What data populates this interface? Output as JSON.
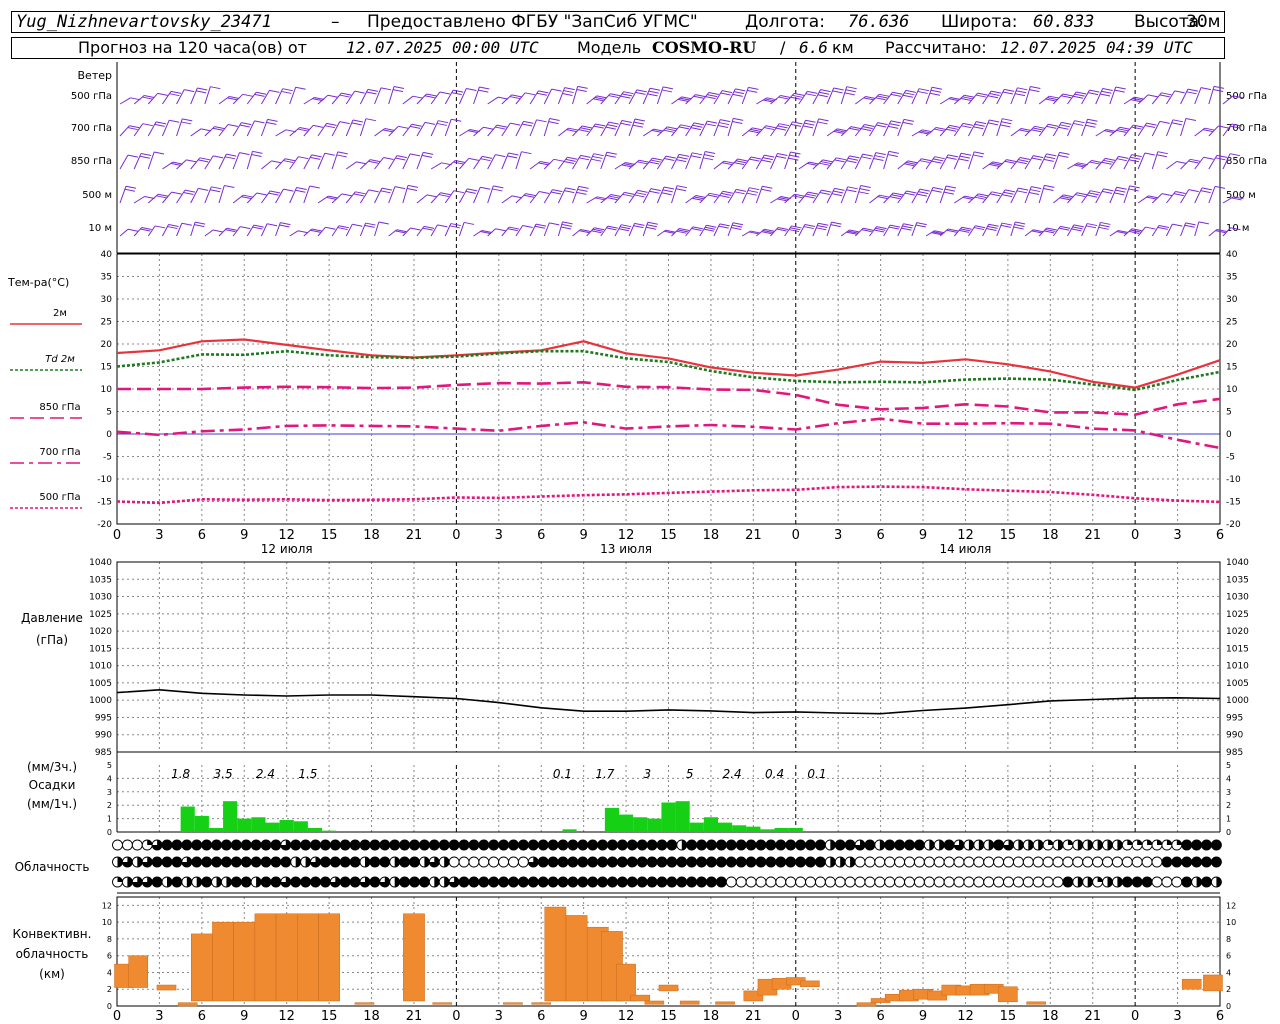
{
  "header": {
    "station": "Yug_Nizhnevartovsky_23471",
    "dash": "–",
    "provider": "Предоставлено ФГБУ \"ЗапСиб УГМС\"",
    "lon_label": "Долгота:",
    "lon_value": "76.636",
    "lat_label": "Широта:",
    "lat_value": "60.833",
    "alt_label": "Высота:",
    "alt_value": "30м",
    "forecast_prefix": "Прогноз на 120 часа(ов) от",
    "forecast_time": "12.07.2025 00:00 UTC",
    "model_label": "Модель",
    "model_name": "COSMO-RU",
    "model_res": "6.6",
    "model_unit": "км",
    "computed_label": "Рассчитано:",
    "computed_time": "12.07.2025 04:39 UTC"
  },
  "wind_panel": {
    "title": "Ветер",
    "levels": [
      "500 гПа",
      "700 гПа",
      "850 гПа",
      "500 м",
      "10 м"
    ],
    "barb_color": "#7b2ad0"
  },
  "hour_ticks": [
    "0",
    "3",
    "6",
    "9",
    "12",
    "15",
    "18",
    "21",
    "0",
    "3",
    "6",
    "9",
    "12",
    "15",
    "18",
    "21",
    "0",
    "3",
    "6",
    "9",
    "12",
    "15",
    "18",
    "21",
    "0",
    "3",
    "6"
  ],
  "day_labels": [
    "12 июля",
    "13 июля",
    "14 июля"
  ],
  "chart_data": [
    {
      "type": "line",
      "name": "temperature",
      "title": "Тем-ра(°C)",
      "ylim": [
        -20,
        40
      ],
      "yticks": [
        "40",
        "35",
        "30",
        "25",
        "20",
        "15",
        "10",
        "5",
        "0",
        "-5",
        "-10",
        "-15",
        "-20"
      ],
      "x_hours": [
        0,
        3,
        6,
        9,
        12,
        15,
        18,
        21,
        24,
        27,
        30,
        33,
        36,
        39,
        42,
        45,
        48,
        51,
        54,
        57,
        60,
        63,
        66,
        69,
        72,
        75,
        78
      ],
      "series": [
        {
          "name": "2м",
          "style": "solid",
          "color": "#e8323c",
          "values": [
            18,
            18.6,
            20.6,
            21,
            19.8,
            18.6,
            17.5,
            17,
            17.5,
            18.1,
            18.6,
            20.6,
            17.9,
            16.8,
            14.8,
            13.6,
            13,
            14.3,
            16.1,
            15.8,
            16.6,
            15.5,
            13.9,
            11.6,
            10.3,
            13.2,
            16.4
          ]
        },
        {
          "name": "Td 2м",
          "style": "dotted",
          "color": "#1e7a1e",
          "values": [
            15,
            15.9,
            17.7,
            17.6,
            18.4,
            17.5,
            17.1,
            16.9,
            17.2,
            17.9,
            18.4,
            18.4,
            16.8,
            16,
            14,
            12.6,
            11.8,
            11.5,
            11.6,
            11.5,
            12.1,
            12.3,
            12.1,
            11,
            9.8,
            12,
            13.8
          ]
        },
        {
          "name": "850 гПа",
          "style": "dashed",
          "color": "#e0177e",
          "values": [
            10,
            10,
            10,
            10.3,
            10.5,
            10.4,
            10.2,
            10.3,
            10.9,
            11.3,
            11.2,
            11.5,
            10.5,
            10.4,
            9.9,
            9.8,
            8.7,
            6.5,
            5.5,
            5.8,
            6.6,
            6.1,
            4.8,
            4.8,
            4.3,
            6.6,
            7.8
          ]
        },
        {
          "name": "700 гПа",
          "style": "dashdot",
          "color": "#e0177e",
          "values": [
            0.5,
            -0.2,
            0.6,
            1,
            1.8,
            1.9,
            1.8,
            1.7,
            1.2,
            0.7,
            1.8,
            2.6,
            1.2,
            1.7,
            2,
            1.6,
            1,
            2.4,
            3.4,
            2.3,
            2.3,
            2.4,
            2.3,
            1.2,
            0.8,
            -1.3,
            -3.1
          ]
        },
        {
          "name": "500 гПа",
          "style": "dotted",
          "color": "#e0177e",
          "values": [
            -15,
            -15.3,
            -14.5,
            -14.6,
            -14.5,
            -14.7,
            -14.6,
            -14.5,
            -14.1,
            -14.2,
            -13.9,
            -13.6,
            -13.4,
            -13.1,
            -12.8,
            -12.5,
            -12.4,
            -11.8,
            -11.7,
            -11.8,
            -12.3,
            -12.6,
            -12.9,
            -13.5,
            -14.3,
            -14.8,
            -15.1
          ]
        }
      ]
    },
    {
      "type": "line",
      "name": "pressure",
      "title": "Давление",
      "ylabel": "(гПа)",
      "ylim": [
        985,
        1040
      ],
      "yticks": [
        "1040",
        "1035",
        "1030",
        "1025",
        "1020",
        "1015",
        "1010",
        "1005",
        "1000",
        "995",
        "990",
        "985"
      ],
      "x_hours": [
        0,
        3,
        6,
        9,
        12,
        15,
        18,
        21,
        24,
        27,
        30,
        33,
        36,
        39,
        42,
        45,
        48,
        51,
        54,
        57,
        60,
        63,
        66,
        69,
        72,
        75,
        78
      ],
      "values": [
        1002.2,
        1003,
        1002,
        1001.5,
        1001.2,
        1001.5,
        1001.5,
        1001,
        1000.5,
        999.3,
        997.8,
        996.8,
        996.8,
        997.2,
        996.9,
        996.4,
        996.6,
        996.3,
        996.1,
        997,
        997.7,
        998.7,
        999.8,
        1000.2,
        1000.6,
        1000.7,
        1000.5
      ],
      "color": "#000000"
    },
    {
      "type": "bar",
      "name": "precipitation",
      "ylabel": "(мм/3ч.)",
      "title": "Осадки",
      "unit": "(мм/1ч.)",
      "ylim": [
        0,
        5
      ],
      "yticks": [
        "5",
        "4",
        "3",
        "2",
        "1",
        "0"
      ],
      "color": "#16d016",
      "amount_labels": [
        {
          "hour": 4.5,
          "text": "1.8"
        },
        {
          "hour": 7.5,
          "text": "3.5"
        },
        {
          "hour": 10.5,
          "text": "2.4"
        },
        {
          "hour": 13.5,
          "text": "1.5"
        },
        {
          "hour": 31.5,
          "text": "0.1"
        },
        {
          "hour": 34.5,
          "text": "1.7"
        },
        {
          "hour": 37.5,
          "text": "3"
        },
        {
          "hour": 40.5,
          "text": "5"
        },
        {
          "hour": 43.5,
          "text": "2.4"
        },
        {
          "hour": 46.5,
          "text": "0.4"
        },
        {
          "hour": 49.5,
          "text": "0.1"
        }
      ],
      "bars": [
        {
          "hour": 5,
          "v": 1.9
        },
        {
          "hour": 6,
          "v": 1.2
        },
        {
          "hour": 7,
          "v": 0.3
        },
        {
          "hour": 8,
          "v": 2.3
        },
        {
          "hour": 9,
          "v": 1
        },
        {
          "hour": 10,
          "v": 1.1
        },
        {
          "hour": 11,
          "v": 0.7
        },
        {
          "hour": 12,
          "v": 0.9
        },
        {
          "hour": 13,
          "v": 0.8
        },
        {
          "hour": 14,
          "v": 0.3
        },
        {
          "hour": 15,
          "v": 0.1
        },
        {
          "hour": 32,
          "v": 0.2
        },
        {
          "hour": 35,
          "v": 1.8
        },
        {
          "hour": 36,
          "v": 1.3
        },
        {
          "hour": 37,
          "v": 1.1
        },
        {
          "hour": 38,
          "v": 1
        },
        {
          "hour": 39,
          "v": 2.2
        },
        {
          "hour": 40,
          "v": 2.3
        },
        {
          "hour": 41,
          "v": 0.7
        },
        {
          "hour": 42,
          "v": 1.1
        },
        {
          "hour": 43,
          "v": 0.7
        },
        {
          "hour": 44,
          "v": 0.5
        },
        {
          "hour": 45,
          "v": 0.4
        },
        {
          "hour": 46,
          "v": 0.2
        },
        {
          "hour": 47,
          "v": 0.3
        },
        {
          "hour": 48,
          "v": 0.3
        }
      ]
    },
    {
      "type": "bar",
      "name": "convective_cloud",
      "title": "Конвективн.",
      "ylabel": "облачность",
      "unit": "(км)",
      "ylim": [
        0,
        13
      ],
      "yticks": [
        "12",
        "10",
        "8",
        "6",
        "4",
        "2",
        "0"
      ],
      "color": "#f08a30",
      "bars": [
        {
          "hour": 0.5,
          "top": 5,
          "base": 2.2
        },
        {
          "hour": 1.5,
          "top": 6,
          "base": 2.2
        },
        {
          "hour": 3.5,
          "top": 2.5,
          "base": 1.9
        },
        {
          "hour": 5,
          "top": 0.4,
          "base": 0
        },
        {
          "hour": 6,
          "top": 8.6,
          "base": 0.6
        },
        {
          "hour": 7.5,
          "top": 10,
          "base": 0.6
        },
        {
          "hour": 9,
          "top": 10,
          "base": 0.6
        },
        {
          "hour": 10.5,
          "top": 11,
          "base": 0.6
        },
        {
          "hour": 12,
          "top": 11,
          "base": 0.6
        },
        {
          "hour": 13.5,
          "top": 11,
          "base": 0.6
        },
        {
          "hour": 15,
          "top": 11,
          "base": 0.6
        },
        {
          "hour": 17.5,
          "top": 0.4,
          "base": 0.2
        },
        {
          "hour": 21,
          "top": 11,
          "base": 0.6
        },
        {
          "hour": 23,
          "top": 0.4,
          "base": 0.2
        },
        {
          "hour": 28,
          "top": 0.4,
          "base": 0.2
        },
        {
          "hour": 30,
          "top": 0.4,
          "base": 0.2
        },
        {
          "hour": 31,
          "top": 11.8,
          "base": 0.6
        },
        {
          "hour": 32.5,
          "top": 10.8,
          "base": 0.6
        },
        {
          "hour": 34,
          "top": 9.4,
          "base": 0.6
        },
        {
          "hour": 35,
          "top": 8.9,
          "base": 0.6
        },
        {
          "hour": 36,
          "top": 5,
          "base": 0.6
        },
        {
          "hour": 37,
          "top": 1.3,
          "base": 0.6
        },
        {
          "hour": 38,
          "top": 0.6,
          "base": 0.2
        },
        {
          "hour": 39,
          "top": 2.5,
          "base": 1.8
        },
        {
          "hour": 40.5,
          "top": 0.6,
          "base": 0.2
        },
        {
          "hour": 43,
          "top": 0.5,
          "base": 0.2
        },
        {
          "hour": 45,
          "top": 1.8,
          "base": 0.6
        },
        {
          "hour": 46,
          "top": 3.2,
          "base": 1.3
        },
        {
          "hour": 47,
          "top": 3.3,
          "base": 2
        },
        {
          "hour": 48,
          "top": 3.4,
          "base": 2.5
        },
        {
          "hour": 49,
          "top": 3,
          "base": 2.3
        },
        {
          "hour": 53,
          "top": 0.4,
          "base": 0
        },
        {
          "hour": 54,
          "top": 0.9,
          "base": 0.4
        },
        {
          "hour": 55,
          "top": 1.4,
          "base": 0.6
        },
        {
          "hour": 56,
          "top": 1.9,
          "base": 0.6
        },
        {
          "hour": 57,
          "top": 2,
          "base": 0.8
        },
        {
          "hour": 58,
          "top": 1.8,
          "base": 0.7
        },
        {
          "hour": 59,
          "top": 2.5,
          "base": 1.3
        },
        {
          "hour": 60,
          "top": 2.4,
          "base": 1.3
        },
        {
          "hour": 61,
          "top": 2.6,
          "base": 1.3
        },
        {
          "hour": 62,
          "top": 2.6,
          "base": 1.5
        },
        {
          "hour": 63,
          "top": 2.3,
          "base": 0.5
        },
        {
          "hour": 65,
          "top": 0.5,
          "base": 0.2
        },
        {
          "hour": 76,
          "top": 3.2,
          "base": 2
        },
        {
          "hour": 77.5,
          "top": 3.7,
          "base": 1.8
        }
      ]
    }
  ],
  "cloudiness": {
    "title": "Облачность",
    "rows": [
      "000000000000000000000222222000000000000000000000000000000000000000000000000000000000000000000000000000000000000000000000000000000000000000000000000000000000000000000000000000000000000000000000000000000000000000000000000000000000000000000000000000000",
      "",
      ""
    ],
    "row_codes": [
      "0001344444444444434444444444444444444444444444444444444442444444444444442443424444224322243222121222221111114444",
      "2323444344444444442234444244244232000000003444444444444444444444444444442220000000000000000000000000000000444444",
      "1233424224224424434444344343244422344444444444444444444444444400000000000000000000000000000000004221224440004242"
    ]
  },
  "colors": {
    "wind": "#7b2ad0",
    "precip": "#16d016",
    "convective": "#f08a30",
    "grid": "#8a8a8a",
    "zero_line": "#3b3bd0"
  }
}
